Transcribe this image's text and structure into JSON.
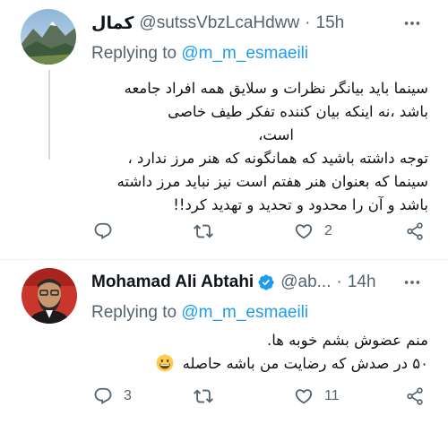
{
  "tweets": [
    {
      "display_name": "کمال",
      "handle": "@sutssVbzLcaHdww",
      "separator": "·",
      "time": "15h",
      "replying_prefix": "Replying to",
      "replying_mention": "@m_m_esmaeili",
      "text_lines": [
        "سینما باید بیانگر نظرات و سلایق همه افراد جامعه",
        "باشد ،نه اینکه بیان کننده تفکر طیف خاصی",
        "است،",
        "توجه داشته باشید که همانگونه که هنر مرز ندارد ،",
        "سینما که بعنوان هنر هفتم است نیز نباید مرز داشته",
        "باشد و آن را محدود و تحدید و تهدید کرد!!"
      ],
      "reply_count": "",
      "retweet_count": "",
      "like_count": "2",
      "verified": false
    },
    {
      "display_name": "Mohamad Ali Abtahi",
      "handle": "@ab...",
      "separator": "·",
      "time": "14h",
      "replying_prefix": "Replying to",
      "replying_mention": "@m_m_esmaeili",
      "text_lines": [
        "منم عضوش بشم خوبه ها.",
        "۵۰ در صدش که رضایت من باشه حاصله"
      ],
      "emoji": "grinning-face-emoji",
      "reply_count": "3",
      "retweet_count": "",
      "like_count": "11",
      "verified": true
    }
  ],
  "colors": {
    "link": "#1d9bf0",
    "secondary_text": "#536471",
    "primary_text": "#0f1419",
    "divider": "#eff3f4",
    "thread_line": "#cfd9de",
    "verified_badge": "#1d9bf0"
  },
  "icons": {
    "reply": "reply-icon",
    "retweet": "retweet-icon",
    "like": "heart-icon",
    "share": "share-icon",
    "more": "more-options-icon"
  }
}
